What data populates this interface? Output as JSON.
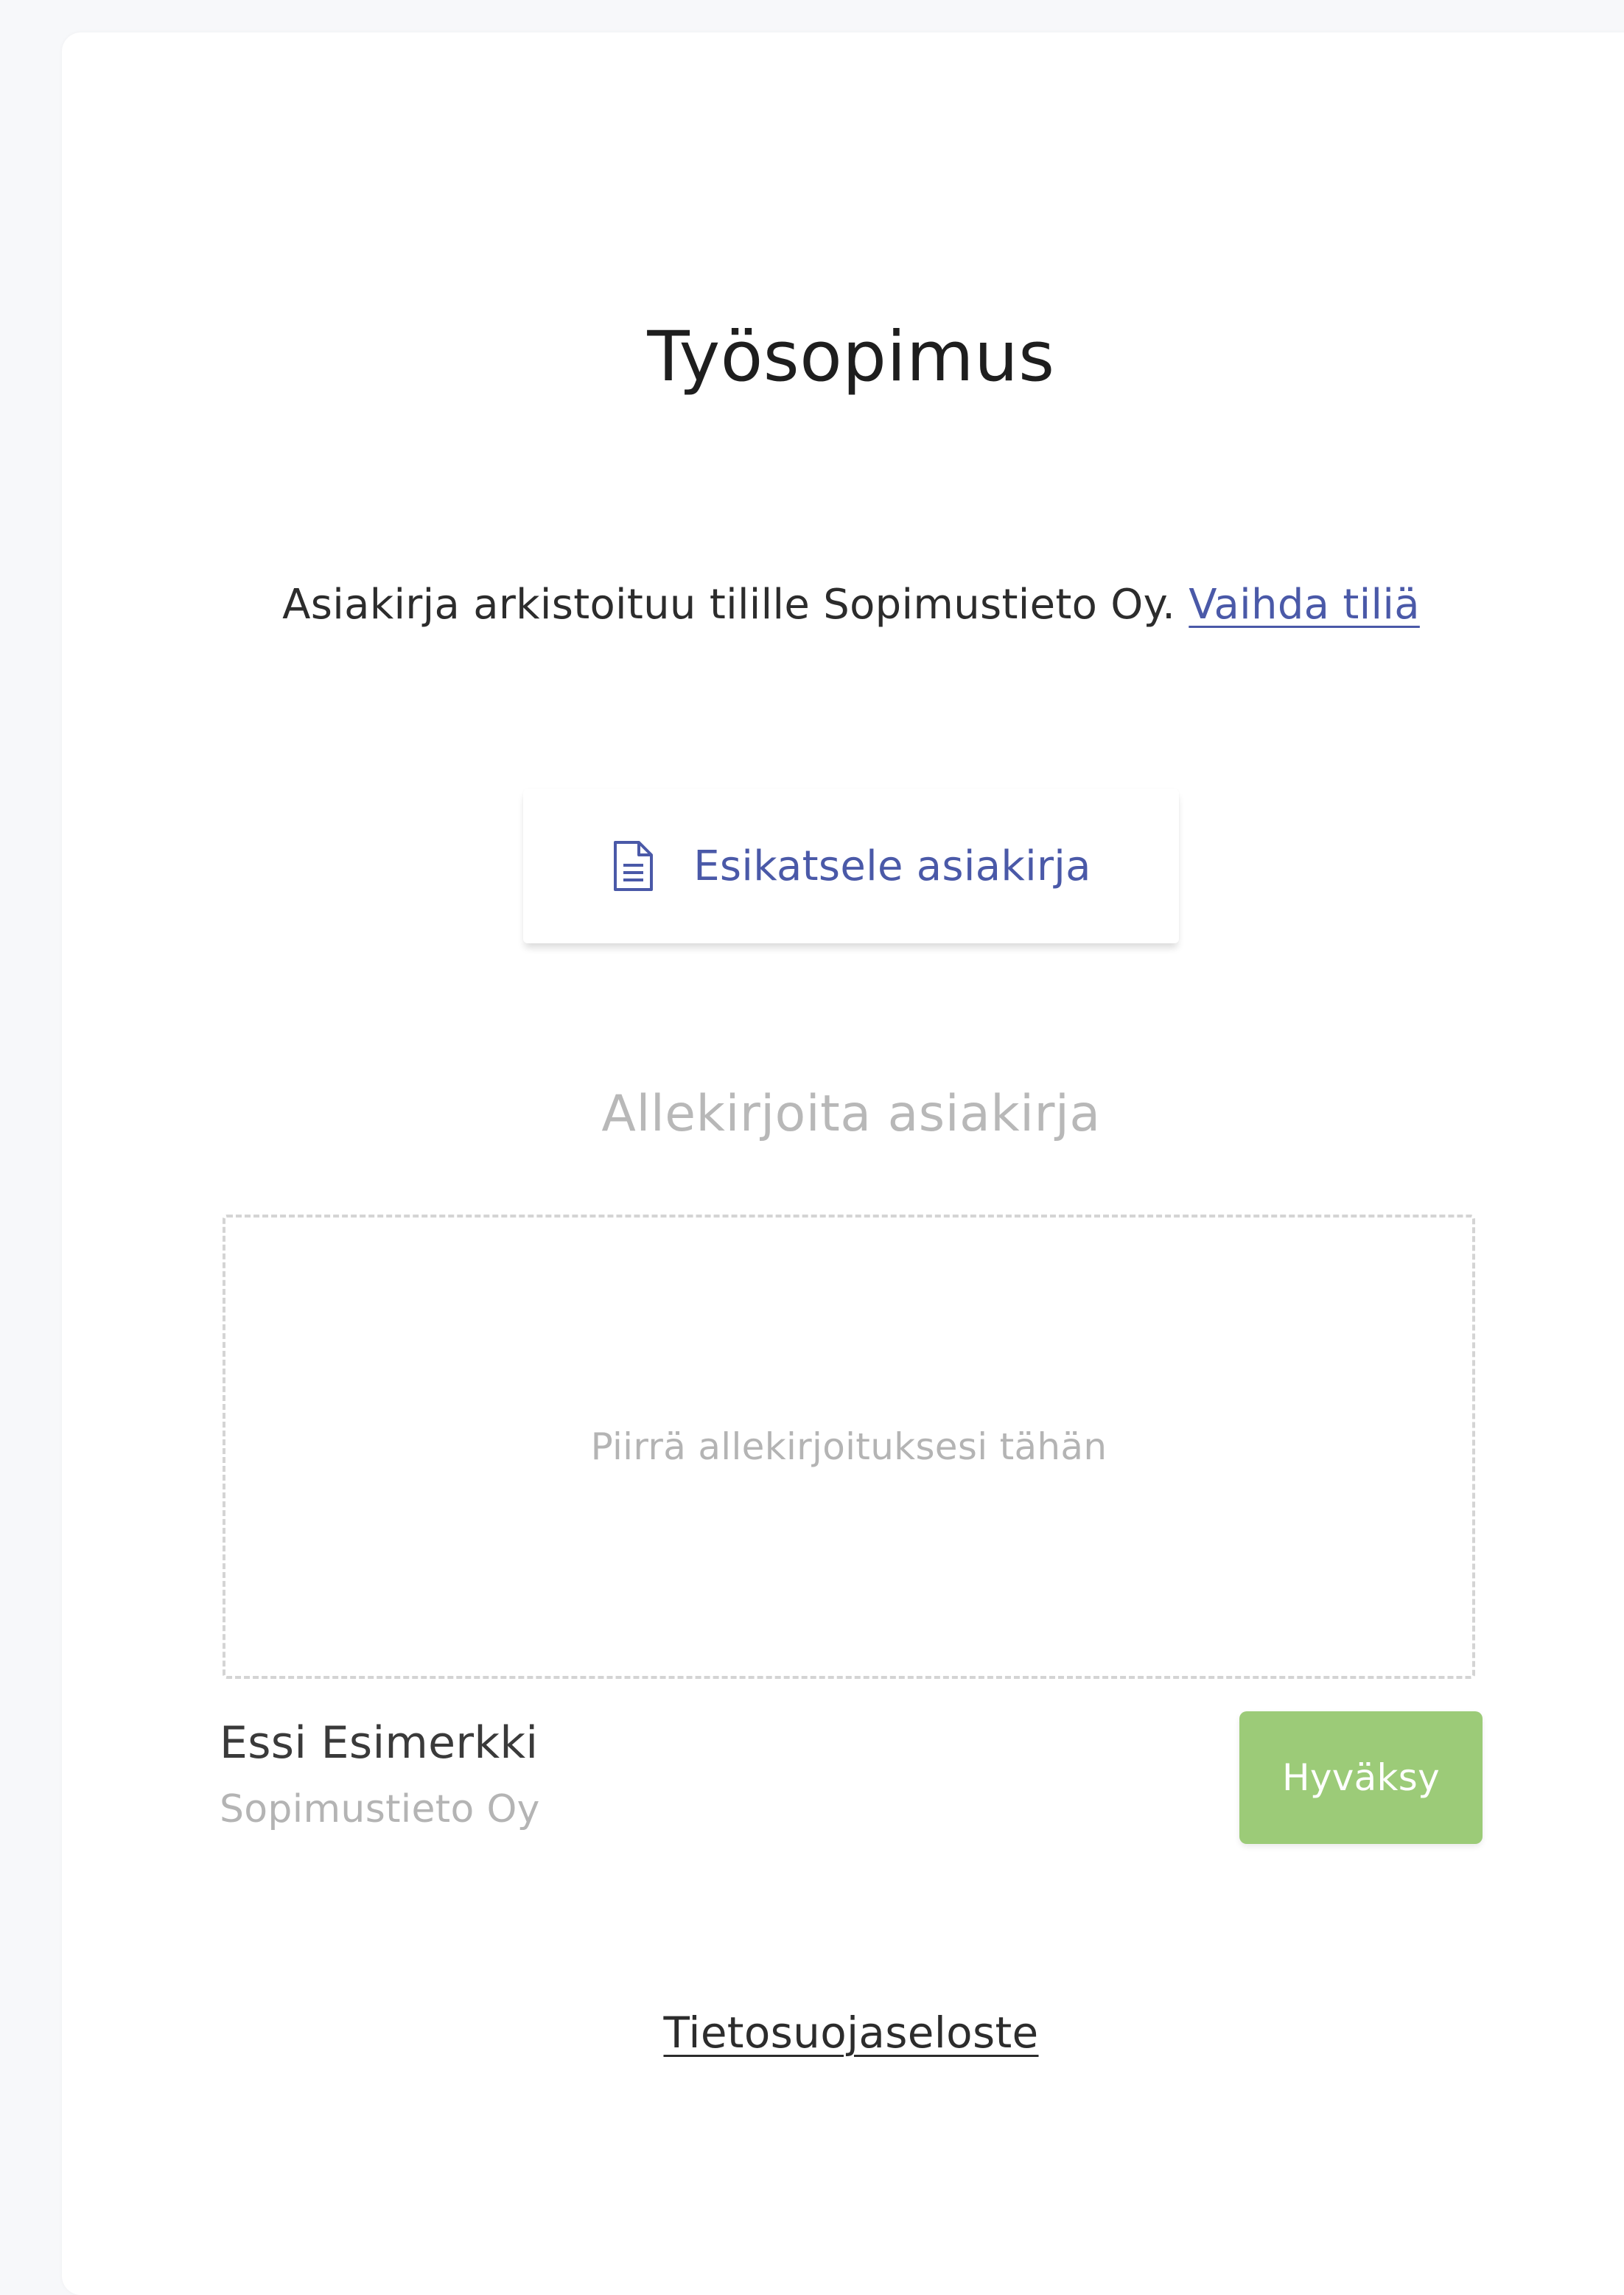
{
  "document": {
    "title": "Työsopimus"
  },
  "archive": {
    "text": "Asiakirja arkistoituu tilille Sopimustieto Oy.",
    "change_link": "Vaihda tiliä"
  },
  "preview": {
    "icon": "document-icon",
    "label": "Esikatsele asiakirja"
  },
  "signature": {
    "heading": "Allekirjoita asiakirja",
    "placeholder": "Piirrä allekirjoituksesi tähän",
    "signer_name": "Essi Esimerkki",
    "signer_organization": "Sopimustieto Oy",
    "accept_label": "Hyväksy"
  },
  "footer": {
    "privacy_link": "Tietosuojaseloste"
  },
  "colors": {
    "accent": "#4a59a8",
    "accept_button": "#9ccb78",
    "muted_text": "#b4b4b4"
  }
}
